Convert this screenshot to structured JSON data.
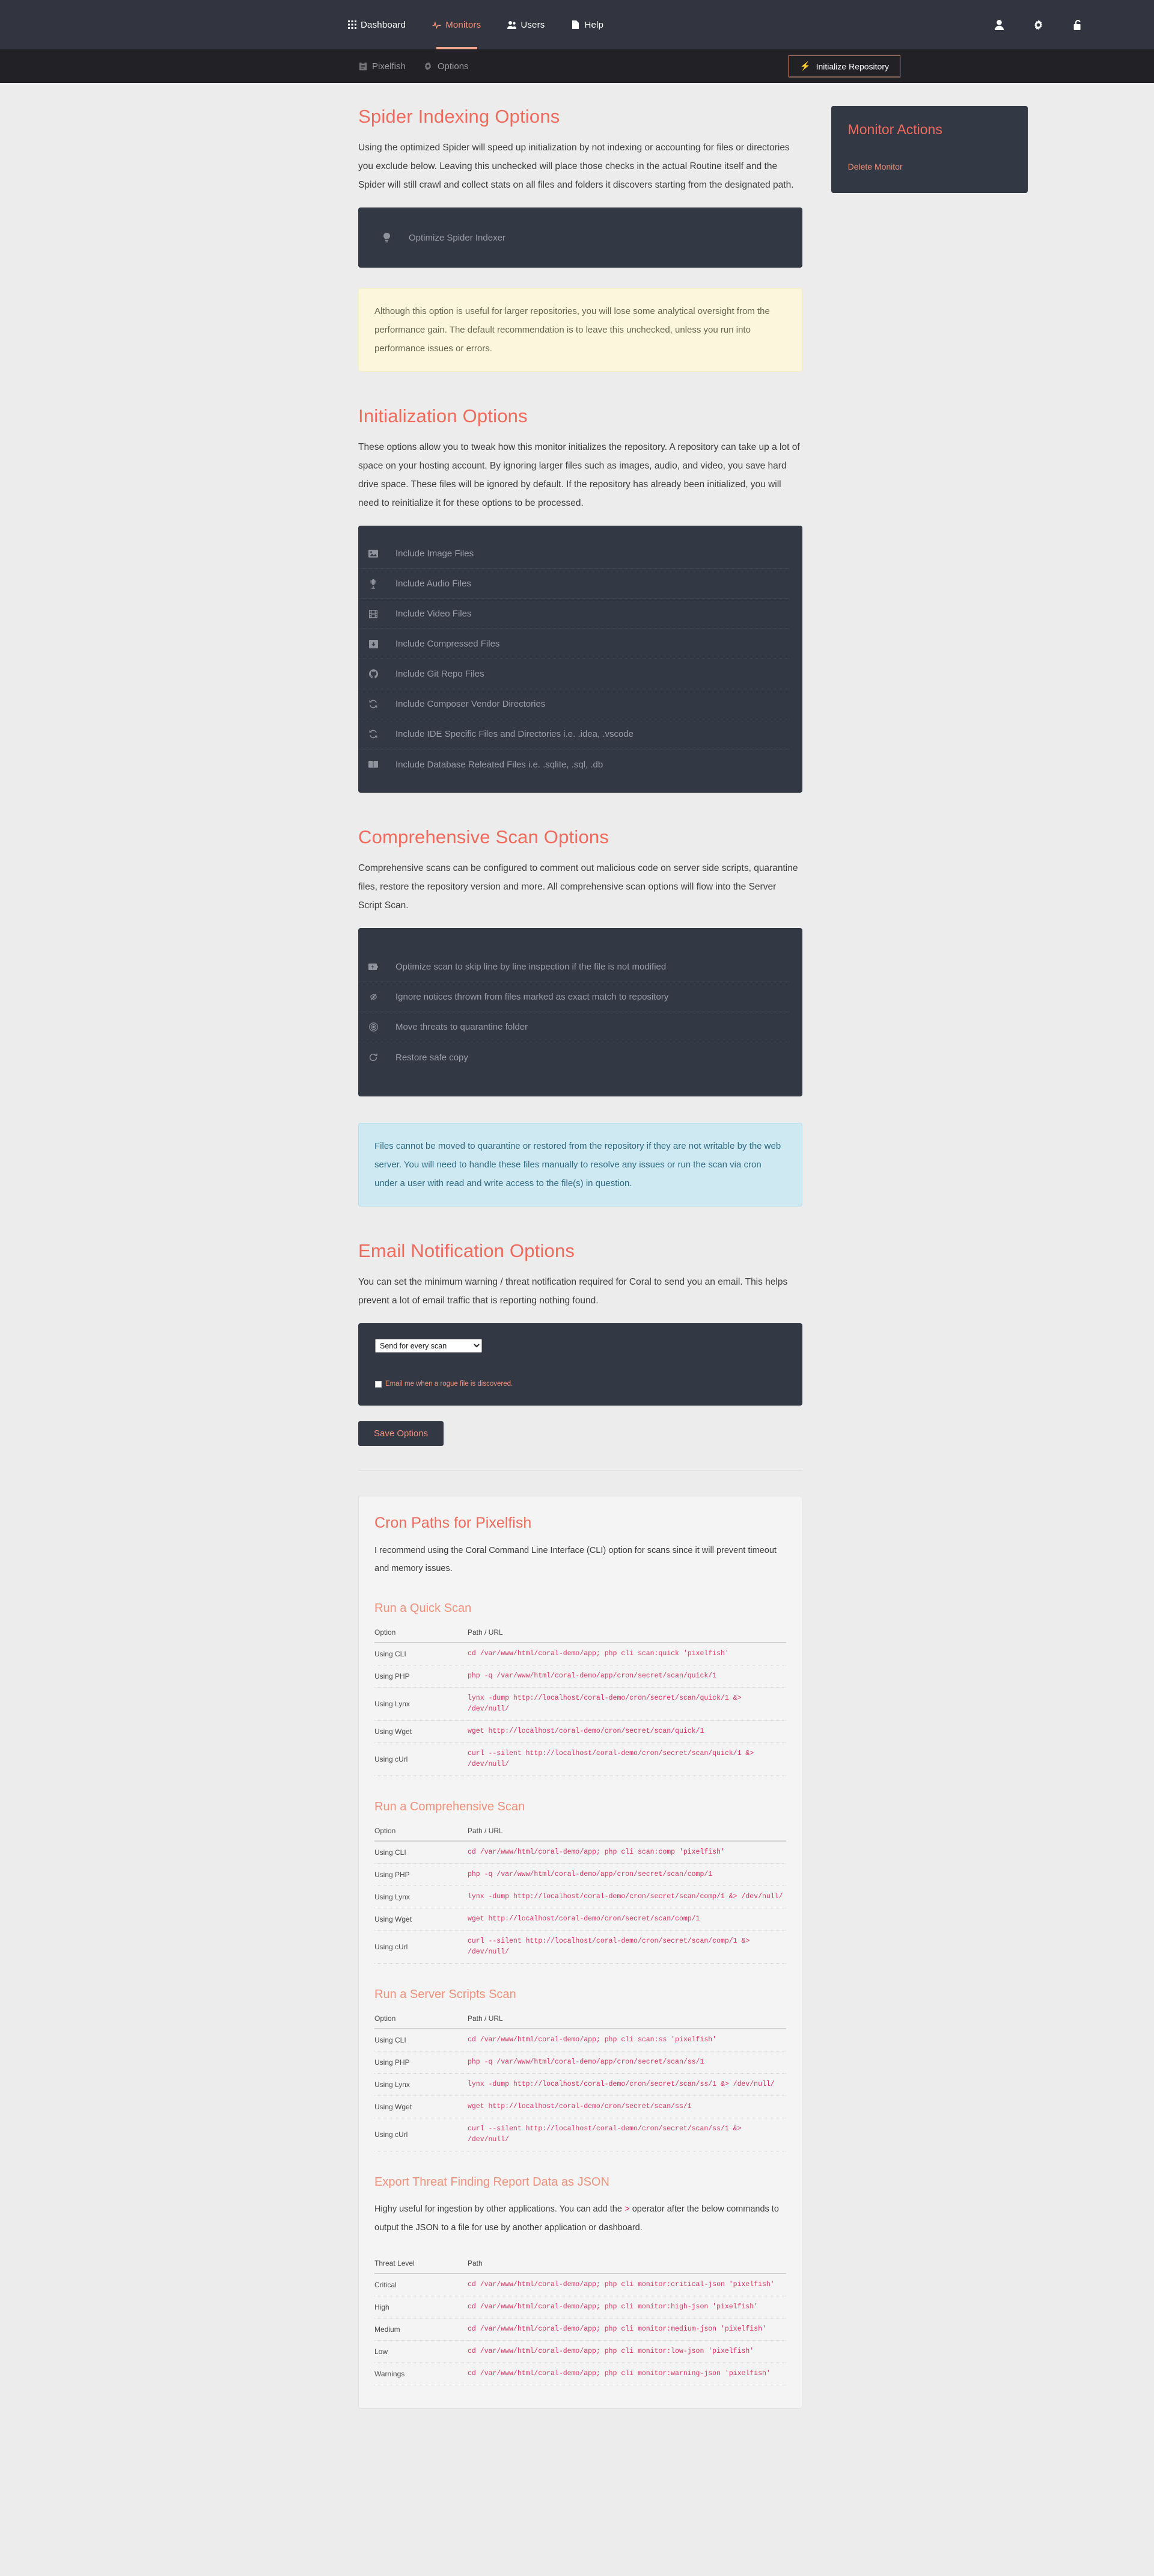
{
  "topnav": {
    "items": [
      {
        "label": "Dashboard",
        "icon": "grid-icon",
        "active": false
      },
      {
        "label": "Monitors",
        "icon": "activity-icon",
        "active": true
      },
      {
        "label": "Users",
        "icon": "users-icon",
        "active": false
      },
      {
        "label": "Help",
        "icon": "file-icon",
        "active": false
      }
    ],
    "right_icons": [
      "user-icon",
      "gear-icon",
      "lock-icon"
    ]
  },
  "subnav": {
    "items": [
      {
        "label": "Pixelfish",
        "icon": "clipboard-icon"
      },
      {
        "label": "Options",
        "icon": "gear-icon"
      }
    ],
    "init_button": "Initialize Repository"
  },
  "spider": {
    "title": "Spider Indexing Options",
    "description": "Using the optimized Spider will speed up initialization by not indexing or accounting for files or directories you exclude below. Leaving this unchecked will place those checks in the actual Routine itself and the Spider will still crawl and collect stats on all files and folders it discovers starting from the designated path.",
    "option": "Optimize Spider Indexer",
    "option_icon": "lightbulb-icon",
    "notice": "Although this option is useful for larger repositories, you will lose some analytical oversight from the performance gain. The default recommendation is to leave this unchecked, unless you run into performance issues or errors."
  },
  "initialization": {
    "title": "Initialization Options",
    "description": "These options allow you to tweak how this monitor initializes the repository. A repository can take up a lot of space on your hosting account. By ignoring larger files such as images, audio, and video, you save hard drive space. These files will be ignored by default. If the repository has already been initialized, you will need to reinitialize it for these options to be processed.",
    "options": [
      {
        "label": "Include Image Files",
        "icon": "image-icon"
      },
      {
        "label": "Include Audio Files",
        "icon": "audio-icon"
      },
      {
        "label": "Include Video Files",
        "icon": "film-icon"
      },
      {
        "label": "Include Compressed Files",
        "icon": "archive-icon"
      },
      {
        "label": "Include Git Repo Files",
        "icon": "github-icon"
      },
      {
        "label": "Include Composer Vendor Directories",
        "icon": "sync-icon"
      },
      {
        "label": "Include IDE Specific Files and Directories i.e. .idea, .vscode",
        "icon": "sync-icon"
      },
      {
        "label": "Include Database Releated Files i.e. .sqlite, .sql, .db",
        "icon": "book-icon"
      }
    ]
  },
  "comprehensive": {
    "title": "Comprehensive Scan Options",
    "description": "Comprehensive scans can be configured to comment out malicious code on server side scripts, quarantine files, restore the repository version and more. All comprehensive scan options will flow into the Server Script Scan.",
    "options": [
      {
        "label": "Optimize scan to skip line by line inspection if the file is not modified",
        "icon": "battery-icon"
      },
      {
        "label": "Ignore notices thrown from files marked as exact match to repository",
        "icon": "eye-slash-icon"
      },
      {
        "label": "Move threats to quarantine folder",
        "icon": "biohazard-icon"
      },
      {
        "label": "Restore safe copy",
        "icon": "refresh-icon"
      }
    ],
    "notice": "Files cannot be moved to quarantine or restored from the repository if they are not writable by the web server. You will need to handle these files manually to resolve any issues or run the scan via cron under a user with read and write access to the file(s) in question."
  },
  "email": {
    "title": "Email Notification Options",
    "description": "You can set the minimum warning / threat notification required for Coral to send you an email. This helps prevent a lot of email traffic that is reporting nothing found.",
    "select_value": "Send for every scan",
    "select_options": [
      "Send for every scan"
    ],
    "checkbox_label": "Email me when a rogue file is discovered.",
    "checkbox_checked": false,
    "save_label": "Save Options"
  },
  "cron": {
    "title": "Cron Paths for Pixelfish",
    "description": "I recommend using the Coral Command Line Interface (CLI) option for scans since it will prevent timeout and memory issues.",
    "columns": [
      "Option",
      "Path / URL"
    ],
    "sections": [
      {
        "title": "Run a Quick Scan",
        "rows": [
          {
            "option": "Using CLI",
            "path": "cd /var/www/html/coral-demo/app; php cli scan:quick 'pixelfish'"
          },
          {
            "option": "Using PHP",
            "path": "php -q /var/www/html/coral-demo/app/cron/secret/scan/quick/1"
          },
          {
            "option": "Using Lynx",
            "path": "lynx -dump http://localhost/coral-demo/cron/secret/scan/quick/1 &> /dev/null/"
          },
          {
            "option": "Using Wget",
            "path": "wget http://localhost/coral-demo/cron/secret/scan/quick/1"
          },
          {
            "option": "Using cUrl",
            "path": "curl --silent http://localhost/coral-demo/cron/secret/scan/quick/1 &> /dev/null/"
          }
        ]
      },
      {
        "title": "Run a Comprehensive Scan",
        "rows": [
          {
            "option": "Using CLI",
            "path": "cd /var/www/html/coral-demo/app; php cli scan:comp 'pixelfish'"
          },
          {
            "option": "Using PHP",
            "path": "php -q /var/www/html/coral-demo/app/cron/secret/scan/comp/1"
          },
          {
            "option": "Using Lynx",
            "path": "lynx -dump http://localhost/coral-demo/cron/secret/scan/comp/1 &> /dev/null/"
          },
          {
            "option": "Using Wget",
            "path": "wget http://localhost/coral-demo/cron/secret/scan/comp/1"
          },
          {
            "option": "Using cUrl",
            "path": "curl --silent http://localhost/coral-demo/cron/secret/scan/comp/1 &> /dev/null/"
          }
        ]
      },
      {
        "title": "Run a Server Scripts Scan",
        "rows": [
          {
            "option": "Using CLI",
            "path": "cd /var/www/html/coral-demo/app; php cli scan:ss 'pixelfish'"
          },
          {
            "option": "Using PHP",
            "path": "php -q /var/www/html/coral-demo/app/cron/secret/scan/ss/1"
          },
          {
            "option": "Using Lynx",
            "path": "lynx -dump http://localhost/coral-demo/cron/secret/scan/ss/1 &> /dev/null/"
          },
          {
            "option": "Using Wget",
            "path": "wget http://localhost/coral-demo/cron/secret/scan/ss/1"
          },
          {
            "option": "Using cUrl",
            "path": "curl --silent http://localhost/coral-demo/cron/secret/scan/ss/1 &> /dev/null/"
          }
        ]
      }
    ],
    "export": {
      "title": "Export Threat Finding Report Data as JSON",
      "description_before": "Highy useful for ingestion by other applications. You can add the",
      "description_code": ">",
      "description_after": "operator after the below commands to output the JSON to a file for use by another application or dashboard.",
      "columns": [
        "Threat Level",
        "Path"
      ],
      "rows": [
        {
          "level": "Critical",
          "path": "cd /var/www/html/coral-demo/app; php cli monitor:critical-json 'pixelfish'"
        },
        {
          "level": "High",
          "path": "cd /var/www/html/coral-demo/app; php cli monitor:high-json 'pixelfish'"
        },
        {
          "level": "Medium",
          "path": "cd /var/www/html/coral-demo/app; php cli monitor:medium-json 'pixelfish'"
        },
        {
          "level": "Low",
          "path": "cd /var/www/html/coral-demo/app; php cli monitor:low-json 'pixelfish'"
        },
        {
          "level": "Warnings",
          "path": "cd /var/www/html/coral-demo/app; php cli monitor:warning-json 'pixelfish'"
        }
      ]
    }
  },
  "side": {
    "title": "Monitor Actions",
    "delete_label": "Delete Monitor"
  },
  "colors": {
    "accent": "#f26a5c",
    "accent_light": "#f4907a",
    "panel_dark": "#333845",
    "nav_dark": "#32353f",
    "subnav_dark": "#212126",
    "page_bg": "#ececec",
    "code": "#e0315f"
  }
}
